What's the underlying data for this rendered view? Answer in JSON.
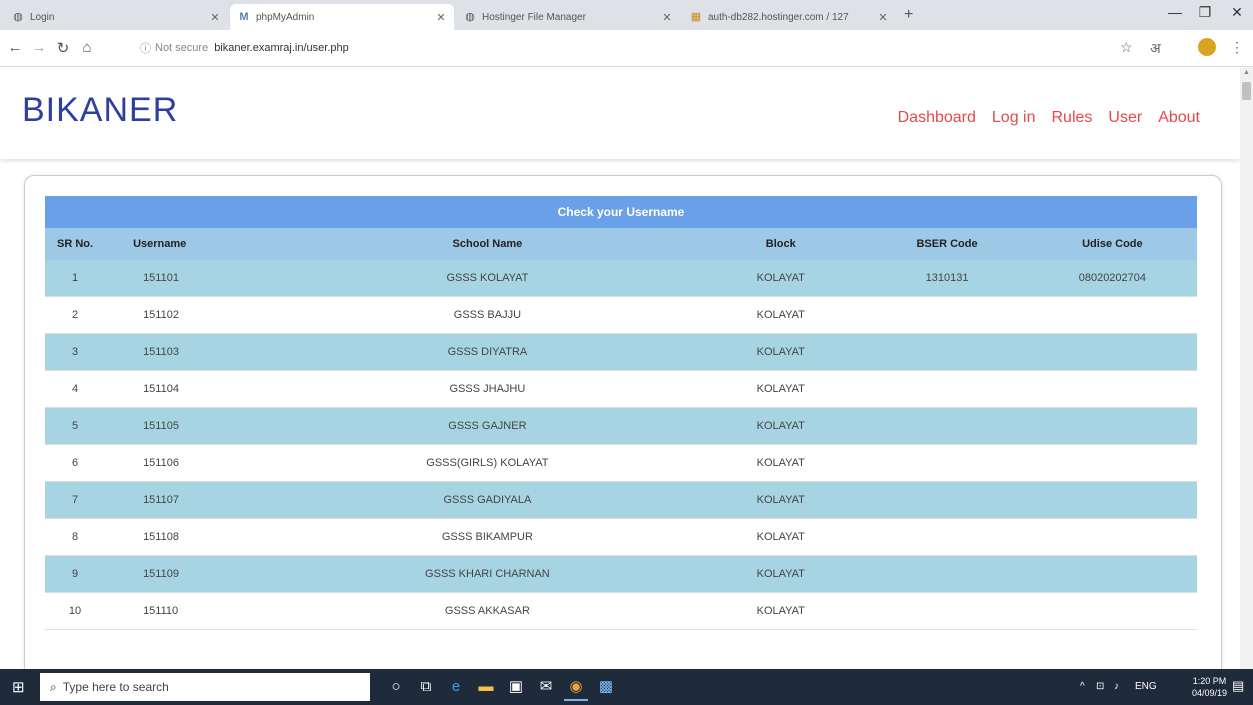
{
  "browser": {
    "tabs": [
      {
        "label": "Login",
        "icon": "globe-icon",
        "active": false
      },
      {
        "label": "phpMyAdmin",
        "icon": "phpmyadmin-icon",
        "active": true
      },
      {
        "label": "Hostinger File Manager",
        "icon": "globe-icon",
        "active": false
      },
      {
        "label": "auth-db282.hostinger.com / 127",
        "icon": "db-icon",
        "active": false
      }
    ],
    "address": {
      "security": "Not secure",
      "url": "bikaner.examraj.in/user.php"
    }
  },
  "site": {
    "brand": "BIKANER",
    "nav": [
      "Dashboard",
      "Log in",
      "Rules",
      "User",
      "About"
    ],
    "accent": "#e8484b",
    "brand_color": "#2f3f9e"
  },
  "table": {
    "title": "Check your Username",
    "headers": [
      "SR No.",
      "Username",
      "School Name",
      "Block",
      "BSER Code",
      "Udise Code"
    ],
    "rows": [
      [
        "1",
        "151101",
        "GSSS KOLAYAT",
        "KOLAYAT",
        "1310131",
        "08020202704"
      ],
      [
        "2",
        "151102",
        "GSSS BAJJU",
        "KOLAYAT",
        "",
        ""
      ],
      [
        "3",
        "151103",
        "GSSS DIYATRA",
        "KOLAYAT",
        "",
        ""
      ],
      [
        "4",
        "151104",
        "GSSS JHAJHU",
        "KOLAYAT",
        "",
        ""
      ],
      [
        "5",
        "151105",
        "GSSS GAJNER",
        "KOLAYAT",
        "",
        ""
      ],
      [
        "6",
        "151106",
        "GSSS(GIRLS) KOLAYAT",
        "KOLAYAT",
        "",
        ""
      ],
      [
        "7",
        "151107",
        "GSSS GADIYALA",
        "KOLAYAT",
        "",
        ""
      ],
      [
        "8",
        "151108",
        "GSSS BIKAMPUR",
        "KOLAYAT",
        "",
        ""
      ],
      [
        "9",
        "151109",
        "GSSS KHARI CHARNAN",
        "KOLAYAT",
        "",
        ""
      ],
      [
        "10",
        "151110",
        "GSSS AKKASAR",
        "KOLAYAT",
        "",
        ""
      ]
    ],
    "header_color": "#6aa0e8",
    "stripe_color": "#a7d4e3"
  },
  "taskbar": {
    "search_placeholder": "Type here to search",
    "lang": "ENG",
    "time": "1:20 PM",
    "date": "04/09/19"
  }
}
